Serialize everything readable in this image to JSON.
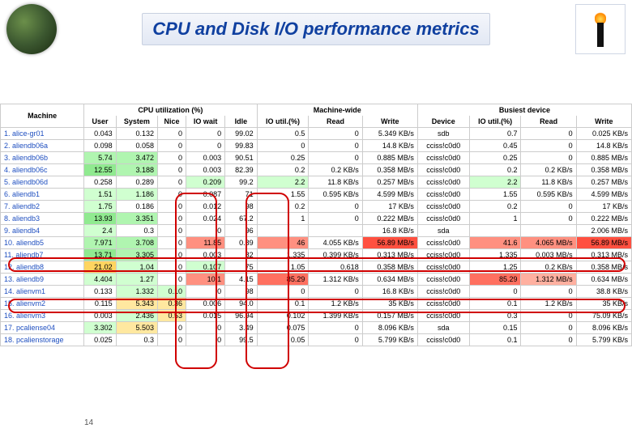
{
  "title": "CPU and Disk I/O performance metrics",
  "page_number": "14",
  "groups": {
    "cpu": "CPU utilization (%)",
    "mw": "Machine-wide",
    "bd": "Busiest device"
  },
  "columns": {
    "machine": "Machine",
    "user": "User",
    "system": "System",
    "nice": "Nice",
    "iowait": "IO wait",
    "idle": "Idle",
    "ioutil1": "IO util.(%)",
    "read1": "Read",
    "write1": "Write",
    "device": "Device",
    "ioutil2": "IO util.(%)",
    "read2": "Read",
    "write2": "Write"
  },
  "rows": [
    {
      "n": "1. alice-gr01",
      "user": "0.043",
      "sys": "0.132",
      "nice": "0",
      "iow": "0",
      "idle": "99.02",
      "iou1": "0.5",
      "r1": "0",
      "w1": "5.349 KB/s",
      "dev": "sdb",
      "iou2": "0.7",
      "r2": "0",
      "w2": "0.025 KB/s"
    },
    {
      "n": "2. aliendb06a",
      "user": "0.098",
      "sys": "0.058",
      "nice": "0",
      "iow": "0",
      "idle": "99.83",
      "iou1": "0",
      "r1": "0",
      "w1": "14.8 KB/s",
      "dev": "cciss!c0d0",
      "iou2": "0.45",
      "r2": "0",
      "w2": "14.8 KB/s"
    },
    {
      "n": "3. aliendb06b",
      "user": "5.74",
      "sys": "3.472",
      "nice": "0",
      "iow": "0.003",
      "idle": "90.51",
      "iou1": "0.25",
      "r1": "0",
      "w1": "0.885 MB/s",
      "dev": "cciss!c0d0",
      "iou2": "0.25",
      "r2": "0",
      "w2": "0.885 MB/s"
    },
    {
      "n": "4. aliendb06c",
      "user": "12.55",
      "sys": "3.188",
      "nice": "0",
      "iow": "0.003",
      "idle": "82.39",
      "iou1": "0.2",
      "r1": "0.2 KB/s",
      "w1": "0.358 MB/s",
      "dev": "cciss!c0d0",
      "iou2": "0.2",
      "r2": "0.2 KB/s",
      "w2": "0.358 MB/s"
    },
    {
      "n": "5. aliendb06d",
      "user": "0.258",
      "sys": "0.289",
      "nice": "0",
      "iow": "0.209",
      "idle": "99.2",
      "iou1": "2.2",
      "r1": "11.8 KB/s",
      "w1": "0.257 MB/s",
      "dev": "cciss!c0d0",
      "iou2": "2.2",
      "r2": "11.8 KB/s",
      "w2": "0.257 MB/s"
    },
    {
      "n": "6. aliendb1",
      "user": "1.51",
      "sys": "1.186",
      "nice": "0",
      "iow": "0.087",
      "idle": "71",
      "iou1": "1.55",
      "r1": "0.595 KB/s",
      "w1": "4.599 MB/s",
      "dev": "cciss!c0d0",
      "iou2": "1.55",
      "r2": "0.595 KB/s",
      "w2": "4.599 MB/s"
    },
    {
      "n": "7. aliendb2",
      "user": "1.75",
      "sys": "0.186",
      "nice": "0",
      "iow": "0.012",
      "idle": "98",
      "iou1": "0.2",
      "r1": "0",
      "w1": "17 KB/s",
      "dev": "cciss!c0d0",
      "iou2": "0.2",
      "r2": "0",
      "w2": "17 KB/s"
    },
    {
      "n": "8. aliendb3",
      "user": "13.93",
      "sys": "3.351",
      "nice": "0",
      "iow": "0.024",
      "idle": "67.2",
      "iou1": "1",
      "r1": "0",
      "w1": "0.222 MB/s",
      "dev": "cciss!c0d0",
      "iou2": "1",
      "r2": "0",
      "w2": "0.222 MB/s"
    },
    {
      "n": "9. aliendb4",
      "user": "2.4",
      "sys": "0.3",
      "nice": "0",
      "iow": "0",
      "idle": "96",
      "iou1": "",
      "r1": "",
      "w1": "16.8 KB/s",
      "dev": "sda",
      "iou2": "",
      "r2": "",
      "w2": "2.006 MB/s"
    },
    {
      "n": "10. aliendb5",
      "user": "7.971",
      "sys": "3.708",
      "nice": "0",
      "iow": "11.85",
      "idle": "0.89",
      "iou1": "46",
      "r1": "4.055 KB/s",
      "w1": "56.89 MB/s",
      "dev": "cciss!c0d0",
      "iou2": "41.6",
      "r2": "4.065 MB/s",
      "w2": "56.89 MB/s"
    },
    {
      "n": "11. aliendb7",
      "user": "13.71",
      "sys": "3.305",
      "nice": "0",
      "iow": "0.003",
      "idle": "82",
      "iou1": "1.335",
      "r1": "0.399 KB/s",
      "w1": "0.313 MB/s",
      "dev": "cciss!c0d0",
      "iou2": "1.335",
      "r2": "0.003 MB/s",
      "w2": "0.313 MB/s"
    },
    {
      "n": "12. aliendb8",
      "user": "21.02",
      "sys": "1.04",
      "nice": "0",
      "iow": "0.107",
      "idle": "75",
      "iou1": "1.05",
      "r1": "0.618",
      "w1": "0.358 MB/s",
      "dev": "cciss!c0d0",
      "iou2": "1.25",
      "r2": "0.2 KB/s",
      "w2": "0.358 MB/s"
    },
    {
      "n": "13. aliendb9",
      "user": "4.404",
      "sys": "1.27",
      "nice": "0",
      "iow": "10.1",
      "idle": "4.15",
      "iou1": "85.29",
      "r1": "1.312 KB/s",
      "w1": "0.634 MB/s",
      "dev": "cciss!c0d0",
      "iou2": "85.29",
      "r2": "1.312 MB/s",
      "w2": "0.634 MB/s"
    },
    {
      "n": "14. alienvm1",
      "user": "0.133",
      "sys": "1.332",
      "nice": "0.10",
      "iow": "0",
      "idle": "98",
      "iou1": "0",
      "r1": "0",
      "w1": "16.8 KB/s",
      "dev": "cciss!c0d0",
      "iou2": "0",
      "r2": "0",
      "w2": "38.8 KB/s"
    },
    {
      "n": "15. alienvm2",
      "user": "0.115",
      "sys": "5.343",
      "nice": "0.36",
      "iow": "0.006",
      "idle": "94.0",
      "iou1": "0.1",
      "r1": "1.2 KB/s",
      "w1": "35 KB/s",
      "dev": "cciss!c0d0",
      "iou2": "0.1",
      "r2": "1.2 KB/s",
      "w2": "35 KB/s"
    },
    {
      "n": "16. alienvm3",
      "user": "0.003",
      "sys": "2.436",
      "nice": "0.53",
      "iow": "0.015",
      "idle": "96.94",
      "iou1": "0.102",
      "r1": "1.399 KB/s",
      "w1": "0.157 MB/s",
      "dev": "cciss!c0d0",
      "iou2": "0.3",
      "r2": "0",
      "w2": "75.09 KB/s"
    },
    {
      "n": "17. pcaliense04",
      "user": "3.302",
      "sys": "5.503",
      "nice": "0",
      "iow": "0",
      "idle": "3.49",
      "iou1": "0.075",
      "r1": "0",
      "w1": "8.096 KB/s",
      "dev": "sda",
      "iou2": "0.15",
      "r2": "0",
      "w2": "8.096 KB/s"
    },
    {
      "n": "18. pcalienstorage",
      "user": "0.025",
      "sys": "0.3",
      "nice": "0",
      "iow": "0",
      "idle": "99.5",
      "iou1": "0.05",
      "r1": "0",
      "w1": "5.799 KB/s",
      "dev": "cciss!c0d0",
      "iou2": "0.1",
      "r2": "0",
      "w2": "5.799 KB/s"
    }
  ]
}
